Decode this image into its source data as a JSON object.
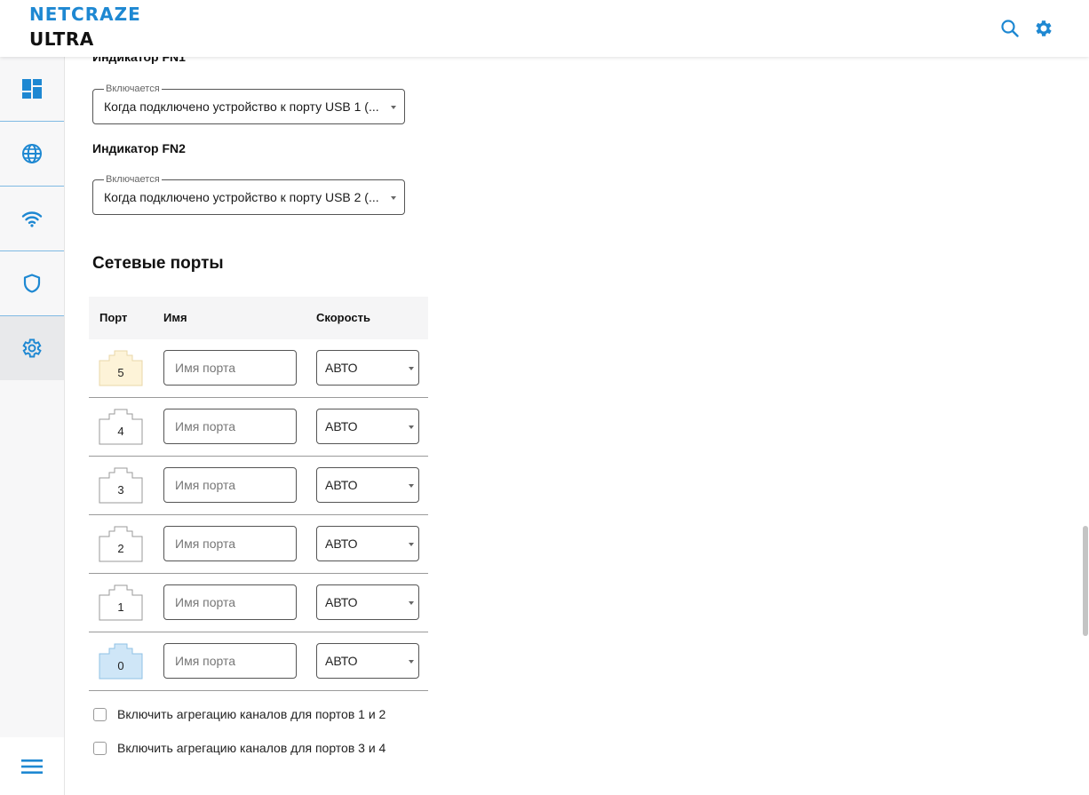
{
  "brand": {
    "line1": "NETCRAZE",
    "line2": "ULTRA",
    "accent": "#1e88d2"
  },
  "header": {
    "icons": [
      "search-icon",
      "gear-icon"
    ]
  },
  "sidebar": {
    "items": [
      {
        "name": "dashboard",
        "icon": "dashboard-icon"
      },
      {
        "name": "internet",
        "icon": "globe-icon"
      },
      {
        "name": "wifi",
        "icon": "wifi-icon"
      },
      {
        "name": "security",
        "icon": "shield-icon"
      },
      {
        "name": "settings",
        "icon": "gear-icon",
        "active": true
      }
    ],
    "bottom_icon": "menu-icon"
  },
  "indicators": {
    "fn1": {
      "title": "Индикатор FN1",
      "legend": "Включается",
      "value": "Когда подключено устройство к порту USB 1 (..."
    },
    "fn2": {
      "title": "Индикатор FN2",
      "legend": "Включается",
      "value": "Когда подключено устройство к порту USB 2 (..."
    }
  },
  "ports_section": {
    "title": "Сетевые порты",
    "columns": {
      "port": "Порт",
      "name": "Имя",
      "speed": "Скорость"
    },
    "name_placeholder": "Имя порта",
    "rows": [
      {
        "port": "5",
        "speed": "АВТО",
        "state": "wan"
      },
      {
        "port": "4",
        "speed": "АВТО",
        "state": "idle"
      },
      {
        "port": "3",
        "speed": "АВТО",
        "state": "idle"
      },
      {
        "port": "2",
        "speed": "АВТО",
        "state": "idle"
      },
      {
        "port": "1",
        "speed": "АВТО",
        "state": "idle"
      },
      {
        "port": "0",
        "speed": "АВТО",
        "state": "active"
      }
    ],
    "port_colors": {
      "wan": "#fdf3d8",
      "idle": "#ffffff",
      "active": "#cfe6f7"
    },
    "aggregation": [
      {
        "label": "Включить агрегацию каналов для портов 1 и 2",
        "checked": false
      },
      {
        "label": "Включить агрегацию каналов для портов 3 и 4",
        "checked": false
      }
    ]
  }
}
